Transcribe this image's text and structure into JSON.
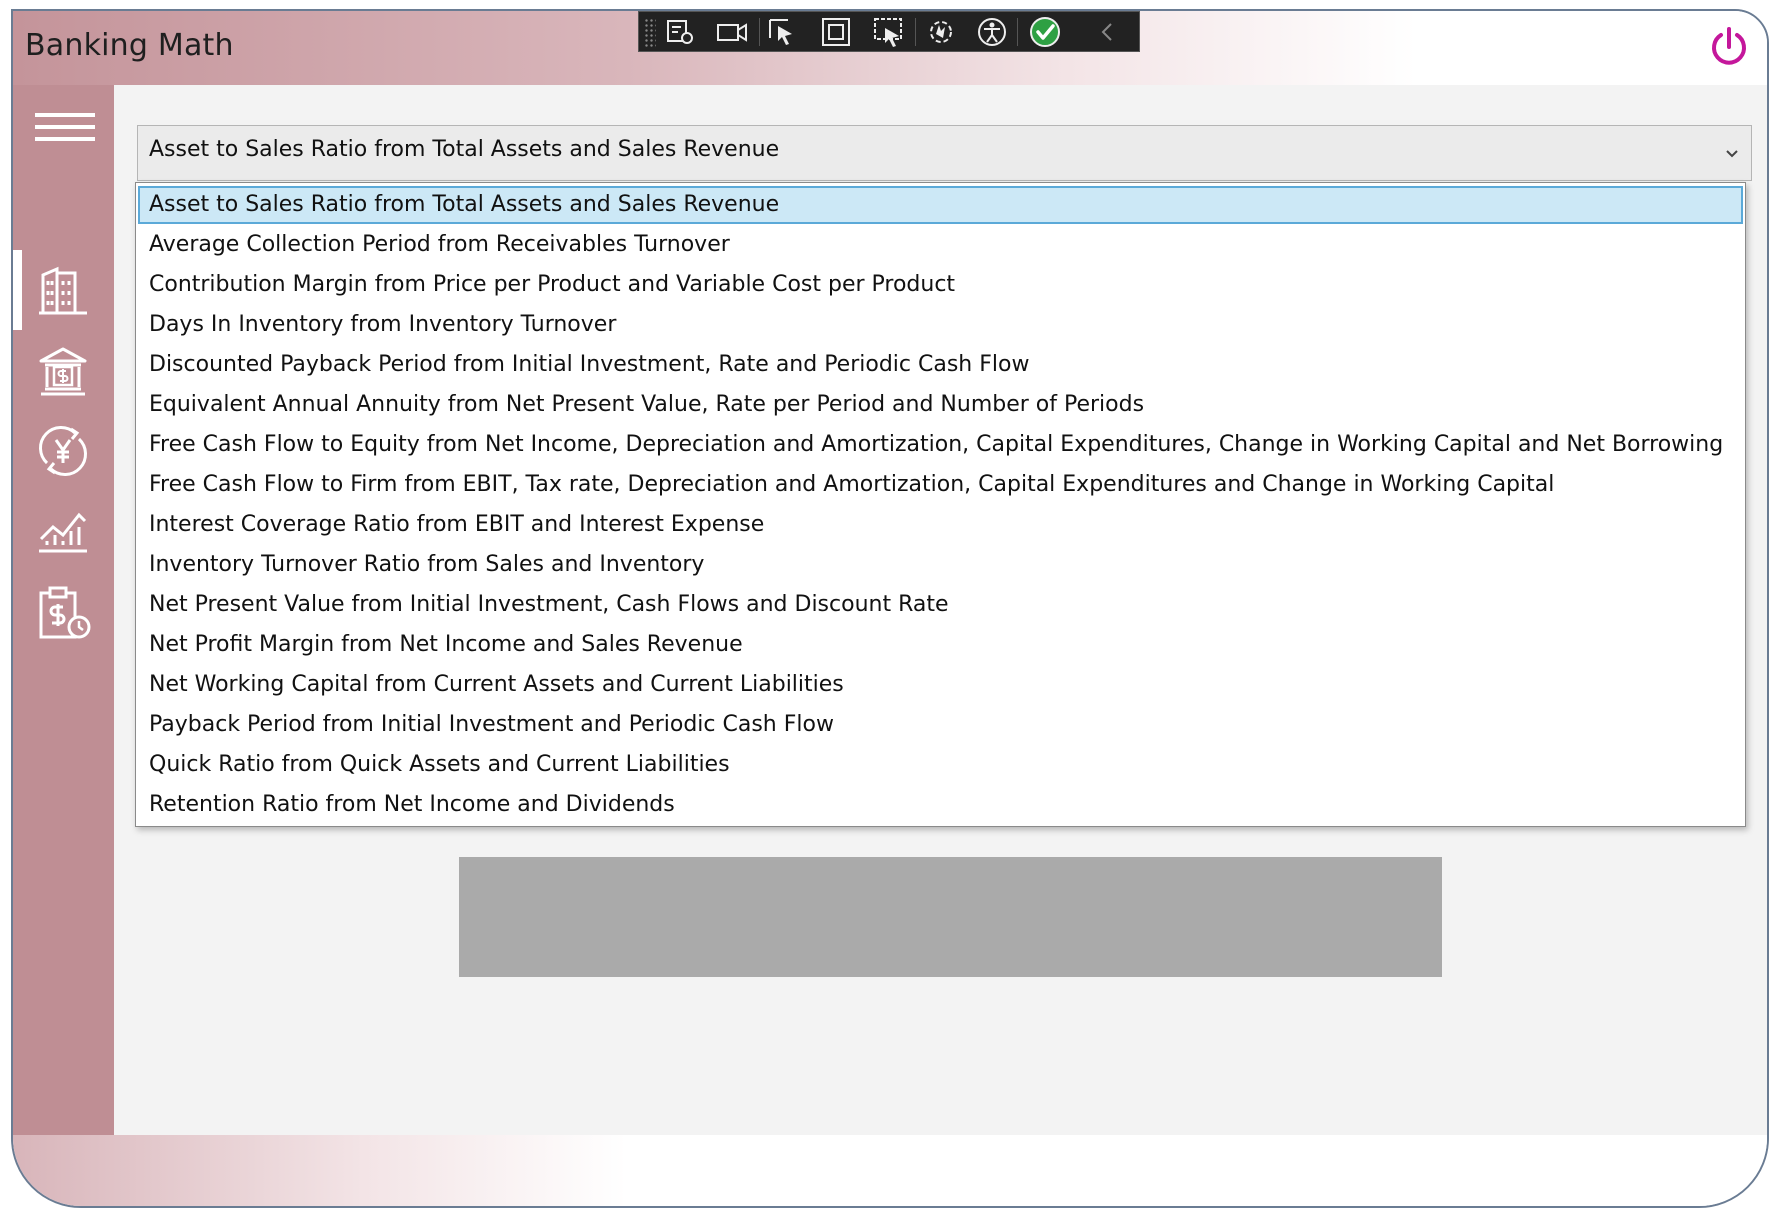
{
  "app": {
    "title": "Banking Math"
  },
  "colors": {
    "sidebar": "#bf8e94",
    "accent": "#c4179b",
    "selection": "#cce8f6",
    "selection_border": "#5ba9d8"
  },
  "debug_toolbar": {
    "buttons": [
      "live-visual-tree-icon",
      "record-icon",
      "select-element-icon",
      "display-layout-adorners-icon",
      "track-focus-icon",
      "hot-reload-icon",
      "accessibility-icon",
      "binding-ok-icon",
      "collapse-icon"
    ]
  },
  "sidebar": {
    "items": [
      {
        "icon": "hamburger-menu-icon"
      },
      {
        "icon": "building-icon"
      },
      {
        "icon": "bank-icon"
      },
      {
        "icon": "currency-exchange-icon"
      },
      {
        "icon": "chart-trend-icon"
      },
      {
        "icon": "clipboard-dollar-icon"
      }
    ],
    "active_index": 1
  },
  "formula_select": {
    "selected": "Asset to Sales Ratio from Total Assets and Sales Revenue",
    "options": [
      "Asset to Sales Ratio from Total Assets and Sales Revenue",
      "Average Collection Period from Receivables Turnover",
      "Contribution Margin from Price per Product and Variable Cost per Product",
      "Days In Inventory from Inventory Turnover",
      "Discounted Payback Period from Initial Investment, Rate and Periodic Cash Flow",
      "Equivalent Annual Annuity from Net Present Value, Rate per Period and Number of Periods",
      "Free Cash Flow to Equity from Net Income, Depreciation and Amortization, Capital Expenditures, Change in Working Capital and Net Borrowing",
      "Free Cash Flow to Firm from EBIT, Tax rate, Depreciation and Amortization, Capital Expenditures and Change in Working Capital",
      "Interest Coverage Ratio from EBIT and Interest Expense",
      "Inventory Turnover Ratio from Sales and Inventory",
      "Net Present Value from Initial Investment, Cash Flows and Discount Rate",
      "Net Profit Margin from Net Income and Sales Revenue",
      "Net Working Capital from Current Assets and Current Liabilities",
      "Payback Period from Initial Investment and Periodic Cash Flow",
      "Quick Ratio from Quick Assets and Current Liabilities",
      "Retention Ratio from Net Income and Dividends"
    ]
  }
}
